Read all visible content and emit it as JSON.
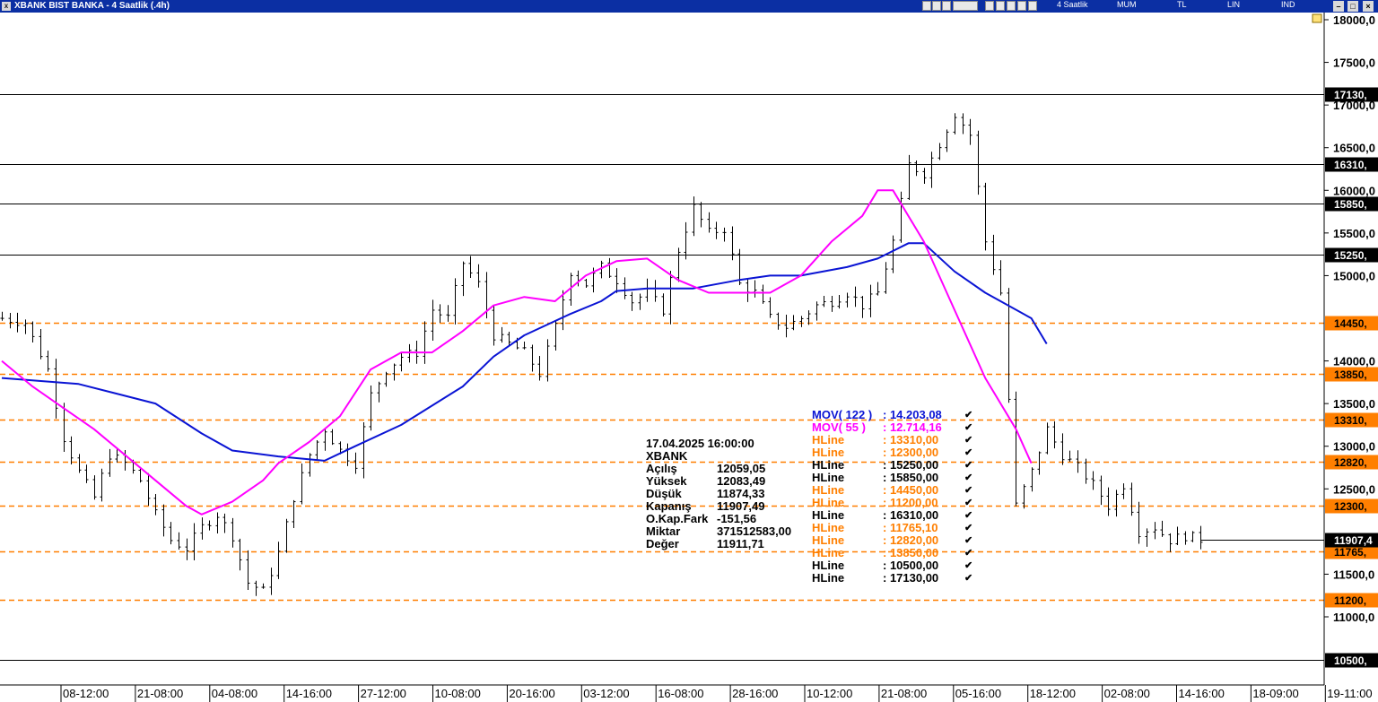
{
  "window": {
    "title": "XBANK BIST BANKA - 4 Saatlik (.4h)"
  },
  "toolbar": {
    "period": "4 Saatlik",
    "chart_style": "MUM",
    "currency": "TL",
    "scale": "LIN",
    "indicator_menu": "IND",
    "tool_icons": [
      "select-icon",
      "zoom-icon",
      "eraser-icon",
      "text-icon",
      "grid-icon",
      "draw-icon",
      "line-icon",
      "fib-icon",
      "arrow-icon"
    ]
  },
  "colors": {
    "mov122": "#0a14d4",
    "mov55": "#ff00ff",
    "hline_orange": "#ff7f00",
    "hline_black": "#000000",
    "title_bg": "#0b2fa3"
  },
  "chart_data": {
    "type": "candlestick",
    "symbol": "XBANK",
    "ylim": [
      10200,
      18100
    ],
    "y_ticks": [
      "18000,0",
      "17500,0",
      "17000,0",
      "16500,0",
      "16000,0",
      "15500,0",
      "15000,0",
      "14000,0",
      "13500,0",
      "13000,0",
      "12500,0",
      "11500,0",
      "11000,0"
    ],
    "x_ticks": [
      "08-12:00",
      "21-08:00",
      "04-08:00",
      "14-16:00",
      "27-12:00",
      "10-08:00",
      "20-16:00",
      "03-12:00",
      "16-08:00",
      "28-16:00",
      "10-12:00",
      "21-08:00",
      "05-16:00",
      "18-12:00",
      "02-08:00",
      "14-16:00",
      "18-09:00",
      "19-11:00"
    ],
    "last_price_label": "11907,4",
    "last_price": 11907.49,
    "hlines": [
      {
        "value": 17130,
        "label": "17130,",
        "color": "black",
        "dashed": false
      },
      {
        "value": 16310,
        "label": "16310,",
        "color": "black",
        "dashed": false
      },
      {
        "value": 15850,
        "label": "15850,",
        "color": "black",
        "dashed": false
      },
      {
        "value": 15250,
        "label": "15250,",
        "color": "black",
        "dashed": false
      },
      {
        "value": 14450,
        "label": "14450,",
        "color": "orange",
        "dashed": true
      },
      {
        "value": 13850,
        "label": "13850,",
        "color": "orange",
        "dashed": true
      },
      {
        "value": 13310,
        "label": "13310,",
        "color": "orange",
        "dashed": true
      },
      {
        "value": 12820,
        "label": "12820,",
        "color": "orange",
        "dashed": true
      },
      {
        "value": 12300,
        "label": "12300,",
        "color": "orange",
        "dashed": true
      },
      {
        "value": 11765.1,
        "label": "11765,",
        "color": "orange",
        "dashed": true
      },
      {
        "value": 11200,
        "label": "11200,",
        "color": "orange",
        "dashed": true
      },
      {
        "value": 10500,
        "label": "10500,",
        "color": "black",
        "dashed": false
      }
    ],
    "price_path": [
      [
        0,
        14500
      ],
      [
        3,
        14450
      ],
      [
        6,
        13900
      ],
      [
        8,
        13100
      ],
      [
        10,
        12700
      ],
      [
        12,
        12400
      ],
      [
        14,
        12900
      ],
      [
        16,
        12800
      ],
      [
        18,
        12600
      ],
      [
        20,
        12200
      ],
      [
        22,
        11900
      ],
      [
        24,
        11800
      ],
      [
        26,
        12050
      ],
      [
        28,
        12200
      ],
      [
        30,
        11950
      ],
      [
        32,
        11400
      ],
      [
        34,
        11300
      ],
      [
        36,
        11750
      ],
      [
        38,
        12400
      ],
      [
        40,
        12900
      ],
      [
        42,
        13200
      ],
      [
        44,
        12950
      ],
      [
        46,
        12800
      ],
      [
        48,
        13600
      ],
      [
        50,
        13900
      ],
      [
        52,
        14050
      ],
      [
        54,
        14100
      ],
      [
        56,
        14600
      ],
      [
        58,
        14500
      ],
      [
        60,
        15150
      ],
      [
        62,
        14900
      ],
      [
        64,
        14300
      ],
      [
        66,
        14200
      ],
      [
        68,
        14100
      ],
      [
        70,
        13850
      ],
      [
        72,
        14400
      ],
      [
        74,
        15050
      ],
      [
        76,
        14900
      ],
      [
        78,
        15100
      ],
      [
        80,
        14950
      ],
      [
        82,
        14700
      ],
      [
        84,
        14800
      ],
      [
        86,
        14600
      ],
      [
        88,
        15300
      ],
      [
        90,
        15800
      ],
      [
        92,
        15500
      ],
      [
        94,
        15550
      ],
      [
        96,
        14900
      ],
      [
        98,
        14800
      ],
      [
        100,
        14500
      ],
      [
        102,
        14400
      ],
      [
        104,
        14500
      ],
      [
        106,
        14650
      ],
      [
        108,
        14700
      ],
      [
        110,
        14800
      ],
      [
        112,
        14650
      ],
      [
        114,
        14800
      ],
      [
        116,
        15400
      ],
      [
        118,
        16300
      ],
      [
        120,
        16200
      ],
      [
        122,
        16550
      ],
      [
        124,
        16900
      ],
      [
        126,
        16650
      ],
      [
        128,
        15400
      ],
      [
        130,
        14800
      ],
      [
        132,
        12300
      ],
      [
        134,
        12700
      ],
      [
        136,
        13200
      ],
      [
        138,
        12900
      ],
      [
        140,
        12750
      ],
      [
        142,
        12550
      ],
      [
        144,
        12300
      ],
      [
        146,
        12550
      ],
      [
        148,
        12000
      ],
      [
        150,
        12050
      ],
      [
        152,
        11900
      ],
      [
        154,
        11950
      ],
      [
        156,
        11907
      ]
    ],
    "series": [
      {
        "name": "MOV( 122 )",
        "values": [
          [
            0,
            13800
          ],
          [
            10,
            13730
          ],
          [
            20,
            13500
          ],
          [
            26,
            13150
          ],
          [
            30,
            12950
          ],
          [
            36,
            12880
          ],
          [
            42,
            12830
          ],
          [
            46,
            13000
          ],
          [
            52,
            13250
          ],
          [
            60,
            13700
          ],
          [
            64,
            14050
          ],
          [
            68,
            14300
          ],
          [
            74,
            14550
          ],
          [
            78,
            14700
          ],
          [
            80,
            14820
          ],
          [
            84,
            14850
          ],
          [
            90,
            14850
          ],
          [
            96,
            14950
          ],
          [
            100,
            15000
          ],
          [
            104,
            15000
          ],
          [
            110,
            15100
          ],
          [
            114,
            15200
          ],
          [
            118,
            15380
          ],
          [
            120,
            15380
          ],
          [
            124,
            15050
          ],
          [
            128,
            14800
          ],
          [
            134,
            14500
          ],
          [
            136,
            14200
          ]
        ]
      },
      {
        "name": "MOV( 55 )",
        "values": [
          [
            0,
            14000
          ],
          [
            4,
            13700
          ],
          [
            8,
            13450
          ],
          [
            12,
            13200
          ],
          [
            16,
            12900
          ],
          [
            20,
            12600
          ],
          [
            24,
            12300
          ],
          [
            26,
            12200
          ],
          [
            30,
            12350
          ],
          [
            34,
            12600
          ],
          [
            36,
            12800
          ],
          [
            40,
            13050
          ],
          [
            44,
            13350
          ],
          [
            48,
            13900
          ],
          [
            52,
            14100
          ],
          [
            56,
            14100
          ],
          [
            60,
            14350
          ],
          [
            64,
            14650
          ],
          [
            68,
            14750
          ],
          [
            72,
            14700
          ],
          [
            76,
            15000
          ],
          [
            80,
            15170
          ],
          [
            84,
            15200
          ],
          [
            88,
            14950
          ],
          [
            92,
            14800
          ],
          [
            96,
            14800
          ],
          [
            100,
            14800
          ],
          [
            104,
            15000
          ],
          [
            108,
            15400
          ],
          [
            112,
            15700
          ],
          [
            114,
            16000
          ],
          [
            116,
            16000
          ],
          [
            120,
            15400
          ],
          [
            124,
            14600
          ],
          [
            128,
            13800
          ],
          [
            132,
            13200
          ],
          [
            134,
            12800
          ]
        ]
      }
    ],
    "legend": [
      {
        "name": "MOV( 122 )",
        "value": ": 14.203,08",
        "color": "#0a14d4"
      },
      {
        "name": "MOV( 55 )",
        "value": ": 12.714,16",
        "color": "#ff00ff"
      },
      {
        "name": "HLine",
        "value": ": 13310,00",
        "color": "#ff7f00"
      },
      {
        "name": "HLine",
        "value": ": 12300,00",
        "color": "#ff7f00"
      },
      {
        "name": "HLine",
        "value": ": 15250,00",
        "color": "#000000"
      },
      {
        "name": "HLine",
        "value": ": 15850,00",
        "color": "#000000"
      },
      {
        "name": "HLine",
        "value": ": 14450,00",
        "color": "#ff7f00"
      },
      {
        "name": "HLine",
        "value": ": 11200,00",
        "color": "#ff7f00"
      },
      {
        "name": "HLine",
        "value": ": 16310,00",
        "color": "#000000"
      },
      {
        "name": "HLine",
        "value": ": 11765,10",
        "color": "#ff7f00"
      },
      {
        "name": "HLine",
        "value": ": 12820,00",
        "color": "#ff7f00"
      },
      {
        "name": "HLine",
        "value": ": 13850,00",
        "color": "#ff7f00"
      },
      {
        "name": "HLine",
        "value": ": 10500,00",
        "color": "#000000"
      },
      {
        "name": "HLine",
        "value": ": 17130,00",
        "color": "#000000"
      }
    ],
    "check_mark": "✔",
    "info_panel": {
      "datetime": "17.04.2025  16:00:00",
      "symbol": "XBANK",
      "rows": [
        {
          "label": "Açılış",
          "value": "12059,05"
        },
        {
          "label": "Yüksek",
          "value": "12083,49"
        },
        {
          "label": "Düşük",
          "value": "11874,33"
        },
        {
          "label": "Kapanış",
          "value": "11907,49"
        },
        {
          "label": "O.Kap.Fark",
          "value": "-151,56"
        },
        {
          "label": "Miktar",
          "value": "371512583,00"
        },
        {
          "label": "Değer",
          "value": "11911,71"
        }
      ]
    }
  }
}
